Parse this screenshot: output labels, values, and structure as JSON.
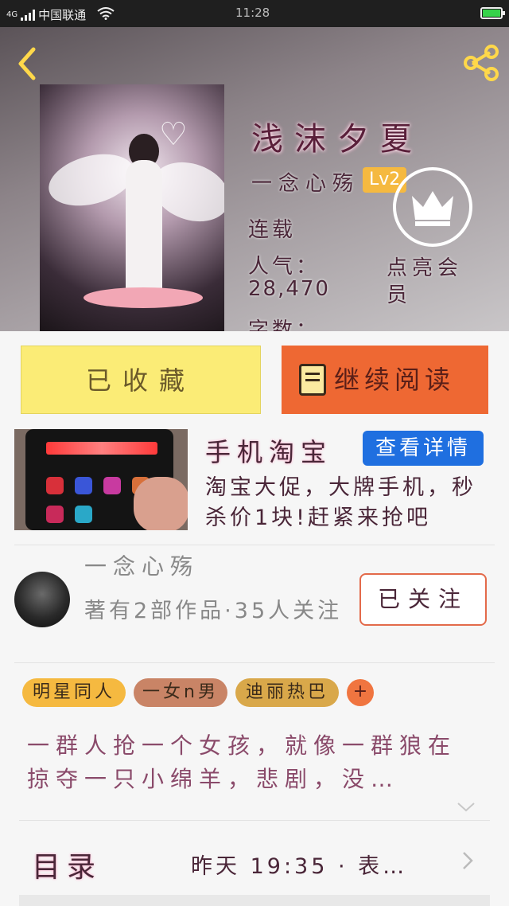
{
  "status_bar": {
    "network": "4G",
    "carrier": "中国联通",
    "time": "11:28",
    "battery_level": 1.0
  },
  "book": {
    "title": "浅沫夕夏",
    "author": "一念心殇",
    "level_badge": "Lv2",
    "status": "连载",
    "popularity_label": "人气：",
    "popularity_value": "28,470",
    "word_count_label": "字数："
  },
  "vip": {
    "label": "点亮会员",
    "icon": "crown-icon"
  },
  "actions": {
    "collect_label": "已收藏",
    "read_label": "继续阅读"
  },
  "ad": {
    "title": "手机淘宝",
    "detail_label": "查看详情",
    "description": "淘宝大促，大牌手机，秒杀价1块!赶紧来抢吧"
  },
  "author_card": {
    "name": "一念心殇",
    "stats": "著有2部作品·35人关注",
    "follow_label": "已关注"
  },
  "tags": [
    {
      "label": "明星同人",
      "color": "#f5b940"
    },
    {
      "label": "一女n男",
      "color": "#c98466"
    },
    {
      "label": "迪丽热巴",
      "color": "#d9a84a"
    }
  ],
  "tag_add_label": "+",
  "intro": "一群人抢一个女孩，就像一群狼在掠夺一只小绵羊，悲剧，没…",
  "toc": {
    "label": "目录",
    "update": "昨天 19:35 · 表…"
  },
  "colors": {
    "accent_yellow": "#ffd84a",
    "collect_bg": "#fbec76",
    "read_bg": "#ee6833",
    "detail_bg": "#1f6fe0",
    "follow_border": "#e36a4a"
  }
}
